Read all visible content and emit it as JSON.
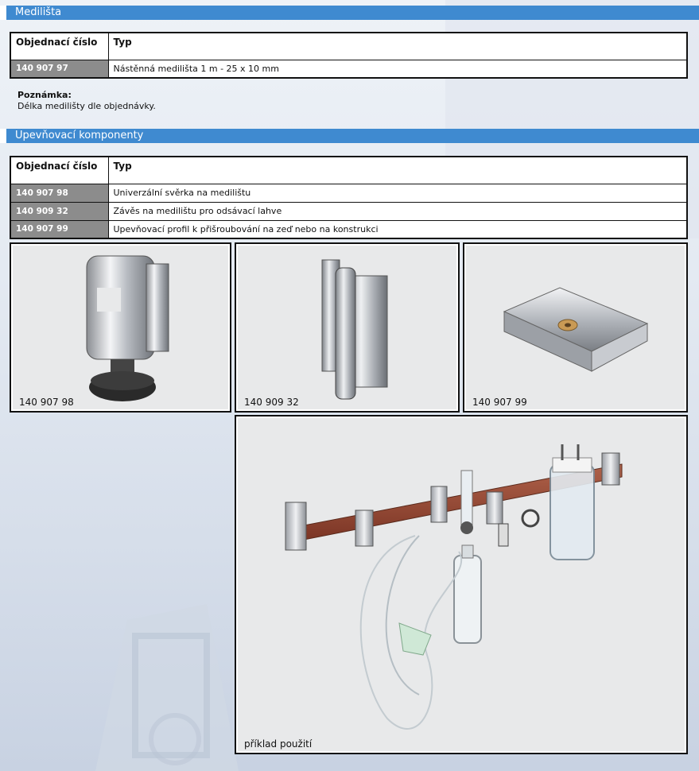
{
  "section1": {
    "title": "Medilišta",
    "table": {
      "header": {
        "col1": "Objednací číslo",
        "col2": "Typ"
      },
      "rows": [
        {
          "code": "140 907 97",
          "type": "Nástěnná medilišta 1 m - 25 x 10 mm"
        }
      ]
    },
    "note": {
      "label": "Poznámka:",
      "text": "Délka medilišty dle objednávky."
    }
  },
  "section2": {
    "title": "Upevňovací komponenty",
    "table": {
      "header": {
        "col1": "Objednací číslo",
        "col2": "Typ"
      },
      "rows": [
        {
          "code": "140 907 98",
          "type": "Univerzální svěrka na medilištu"
        },
        {
          "code": "140 909 32",
          "type": "Závěs na medilištu pro odsávací lahve"
        },
        {
          "code": "140 907 99",
          "type": "Upevňovací profil k přišroubování na zeď nebo na konstrukci"
        }
      ]
    }
  },
  "images": [
    {
      "caption": "140 907 98",
      "icon": "universal-clamp"
    },
    {
      "caption": "140 909 32",
      "icon": "bottle-hanger"
    },
    {
      "caption": "140 907 99",
      "icon": "mounting-profile"
    },
    {
      "caption": "příklad použití",
      "icon": "rail-assembly-example"
    }
  ],
  "colors": {
    "accent": "#3f8ad0",
    "code_cell": "#8c8c8c",
    "rail": "#9b4a36"
  }
}
